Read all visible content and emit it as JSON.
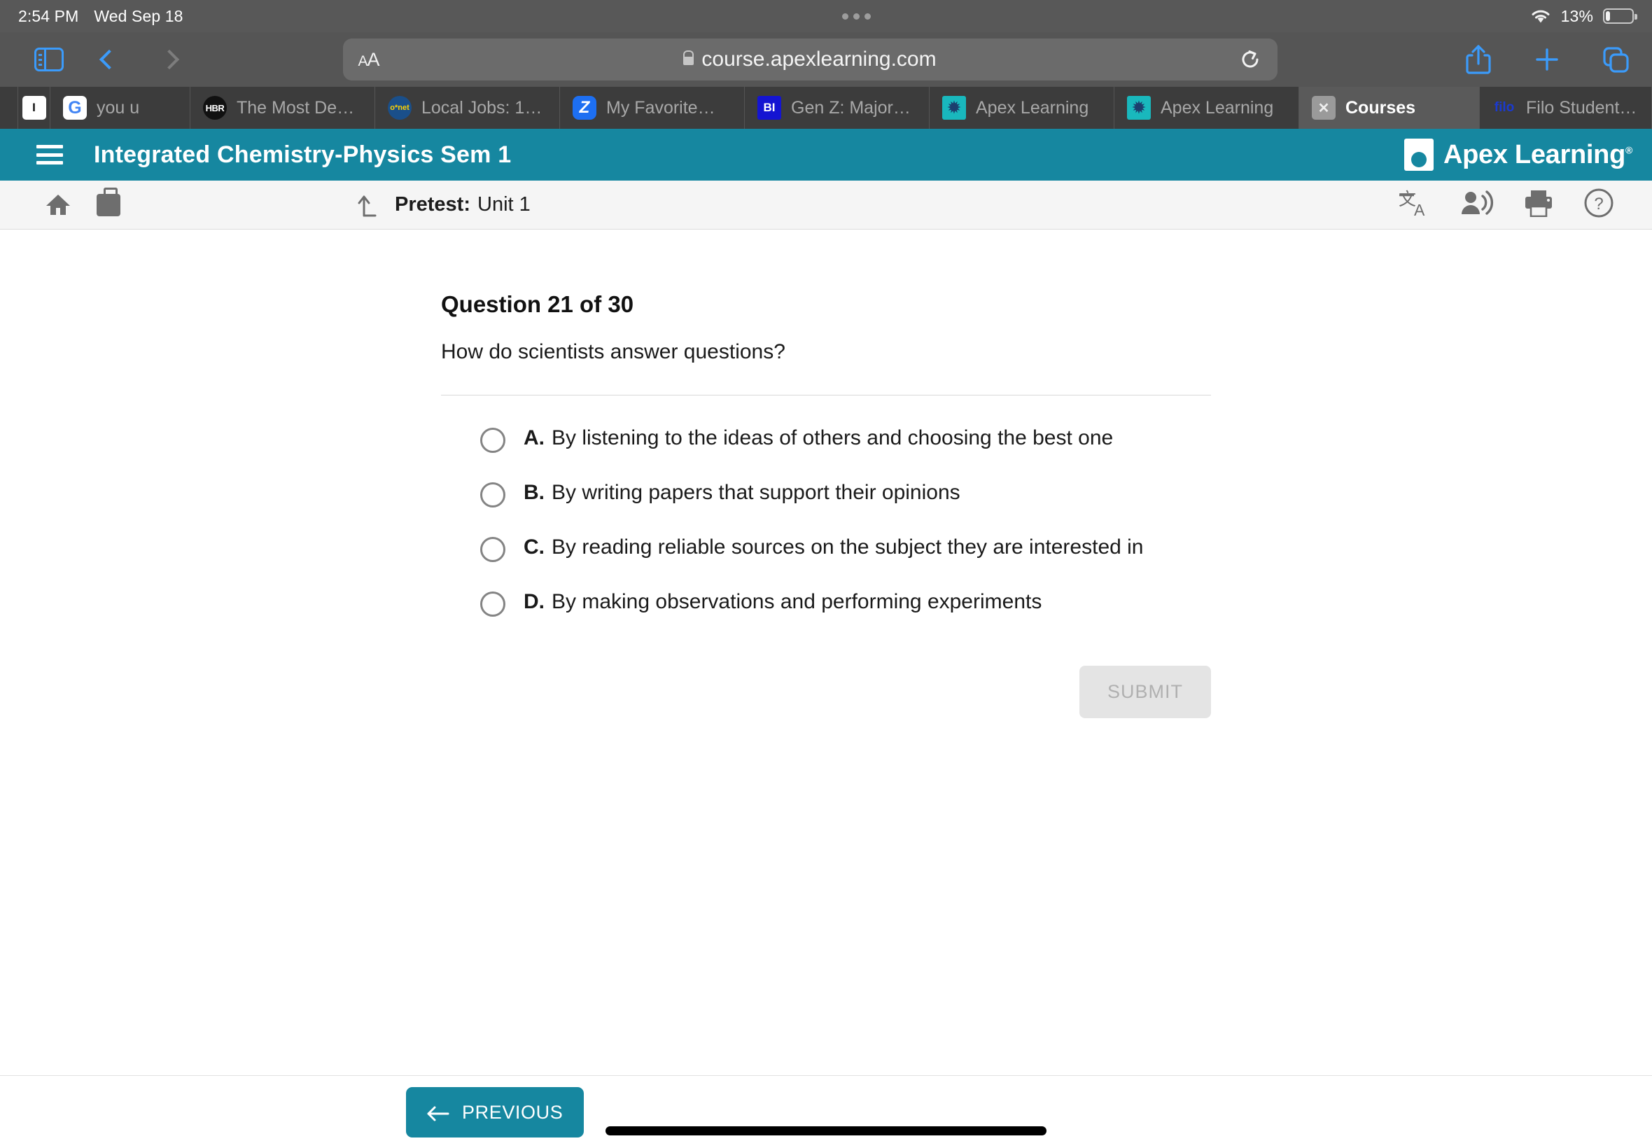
{
  "status_bar": {
    "time": "2:54 PM",
    "date": "Wed Sep 18",
    "battery_percent": "13%",
    "wifi_icon": "wifi-icon",
    "battery_icon": "battery-low-icon"
  },
  "browser": {
    "sidebar_icon": "sidebar-toggle-icon",
    "back_icon": "chevron-left-icon",
    "forward_icon": "chevron-right-icon",
    "text_size_label": "AA",
    "url": "course.apexlearning.com",
    "lock_icon": "lock-icon",
    "reload_icon": "reload-icon",
    "share_icon": "share-icon",
    "new_tab_icon": "plus-icon",
    "tabs_overview_icon": "tabs-overview-icon",
    "tabs": [
      {
        "label": "",
        "favicon": "blank-page-icon",
        "kind": "blank",
        "active": false
      },
      {
        "label": "you u",
        "favicon": "google-icon",
        "kind": "google",
        "active": false
      },
      {
        "label": "The Most De…",
        "favicon": "hbr-icon",
        "kind": "hbr",
        "active": false
      },
      {
        "label": "Local Jobs: 1…",
        "favicon": "onet-icon",
        "kind": "onet",
        "active": false
      },
      {
        "label": "My Favorite…",
        "favicon": "zillow-icon",
        "kind": "z",
        "active": false
      },
      {
        "label": "Gen Z: Major…",
        "favicon": "business-insider-icon",
        "kind": "bi",
        "active": false
      },
      {
        "label": "Apex Learning",
        "favicon": "apex-learning-icon",
        "kind": "apex",
        "active": false
      },
      {
        "label": "Apex Learning",
        "favicon": "apex-learning-icon",
        "kind": "apex",
        "active": false
      },
      {
        "label": "Courses",
        "favicon": "close-tab-icon",
        "kind": "x",
        "active": true
      },
      {
        "label": "Filo Student:…",
        "favicon": "filo-icon",
        "kind": "filo",
        "active": false
      }
    ]
  },
  "app_header": {
    "menu_icon": "hamburger-menu-icon",
    "course_title": "Integrated Chemistry-Physics Sem 1",
    "brand_name": "Apex Learning",
    "brand_trademark": "®",
    "background_color": "#1687a0"
  },
  "toolbar": {
    "home_icon": "home-icon",
    "briefcase_icon": "briefcase-icon",
    "uplevel_icon": "up-level-icon",
    "breadcrumb_label": "Pretest:",
    "breadcrumb_value": "Unit 1",
    "translate_icon": "translate-icon",
    "read_aloud_icon": "read-aloud-icon",
    "print_icon": "print-icon",
    "help_icon": "help-icon"
  },
  "question": {
    "heading": "Question 21 of 30",
    "prompt": "How do scientists answer questions?",
    "options": [
      {
        "letter": "A.",
        "text": "By listening to the ideas of others and choosing the best one",
        "selected": false
      },
      {
        "letter": "B.",
        "text": "By writing papers that support their opinions",
        "selected": false
      },
      {
        "letter": "C.",
        "text": "By reading reliable sources on the subject they are interested in",
        "selected": false
      },
      {
        "letter": "D.",
        "text": "By making observations and performing experiments",
        "selected": false
      }
    ],
    "submit_label": "SUBMIT",
    "submit_enabled": false
  },
  "footer": {
    "previous_label": "PREVIOUS",
    "previous_icon": "arrow-left-icon",
    "home_indicator": "home-indicator"
  }
}
